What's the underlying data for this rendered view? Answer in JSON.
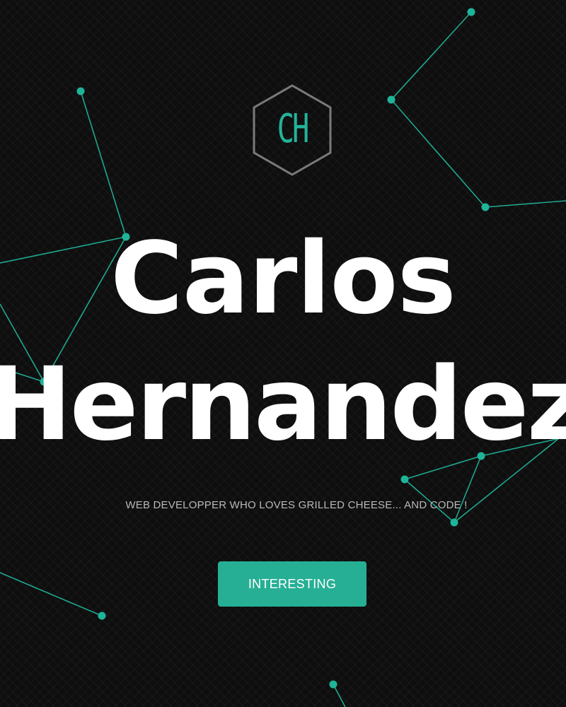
{
  "colors": {
    "background": "#0e0e0e",
    "accent": "#26af95",
    "network_line": "#1fa88f",
    "logo_border": "#7a7a7a",
    "heading": "#ffffff",
    "tagline": "#b9b9b9"
  },
  "logo": {
    "initials": "CH",
    "shape": "hexagon-outline"
  },
  "hero": {
    "first_name": "Carlos",
    "last_name": "Hernandez",
    "tagline": "WEB DEVELOPPER WHO LOVES GRILLED CHEESE... AND CODE !",
    "button_label": "INTERESTING"
  },
  "background_effect": {
    "type": "particle-network"
  }
}
